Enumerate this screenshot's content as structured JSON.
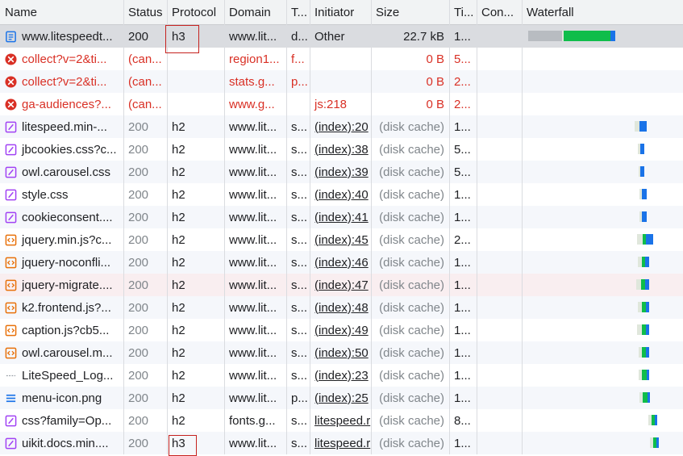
{
  "headers": {
    "name": "Name",
    "status": "Status",
    "protocol": "Protocol",
    "domain": "Domain",
    "type": "T...",
    "initiator": "Initiator",
    "size": "Size",
    "time": "Ti...",
    "connection": "Con...",
    "waterfall": "Waterfall"
  },
  "colors": {
    "error": "#d93025",
    "green": "#0fbd4a",
    "blue": "#1a73e8",
    "highlight": "#c5221f"
  },
  "rows": [
    {
      "icon": "document-icon",
      "name": "www.litespeedt...",
      "status": "200",
      "protocol": "h3",
      "domain": "www.lit...",
      "type": "d...",
      "initiator": "Other",
      "size": "22.7 kB",
      "time": "1...",
      "error": false,
      "link": false,
      "muted": false
    },
    {
      "icon": "error-icon",
      "name": "collect?v=2&ti...",
      "status": "(can...",
      "protocol": "",
      "domain": "region1...",
      "type": "f...",
      "initiator": "",
      "size": "0 B",
      "time": "5...",
      "error": true,
      "link": false,
      "muted": false
    },
    {
      "icon": "error-icon",
      "name": "collect?v=2&ti...",
      "status": "(can...",
      "protocol": "",
      "domain": "stats.g...",
      "type": "p...",
      "initiator": "",
      "size": "0 B",
      "time": "2...",
      "error": true,
      "link": false,
      "muted": false
    },
    {
      "icon": "error-icon",
      "name": "ga-audiences?...",
      "status": "(can...",
      "protocol": "",
      "domain": "www.g...",
      "type": "",
      "initiator": "js:218",
      "size": "0 B",
      "time": "2...",
      "error": true,
      "link": false,
      "muted": false
    },
    {
      "icon": "stylesheet-icon",
      "name": "litespeed.min-...",
      "status": "200",
      "protocol": "h2",
      "domain": "www.lit...",
      "type": "s...",
      "initiator": "(index):20",
      "size": "(disk cache)",
      "time": "1...",
      "error": false,
      "link": true,
      "muted": true
    },
    {
      "icon": "stylesheet-icon",
      "name": "jbcookies.css?c...",
      "status": "200",
      "protocol": "h2",
      "domain": "www.lit...",
      "type": "s...",
      "initiator": "(index):38",
      "size": "(disk cache)",
      "time": "5...",
      "error": false,
      "link": true,
      "muted": true
    },
    {
      "icon": "stylesheet-icon",
      "name": "owl.carousel.css",
      "status": "200",
      "protocol": "h2",
      "domain": "www.lit...",
      "type": "s...",
      "initiator": "(index):39",
      "size": "(disk cache)",
      "time": "5...",
      "error": false,
      "link": true,
      "muted": true
    },
    {
      "icon": "stylesheet-icon",
      "name": "style.css",
      "status": "200",
      "protocol": "h2",
      "domain": "www.lit...",
      "type": "s...",
      "initiator": "(index):40",
      "size": "(disk cache)",
      "time": "1...",
      "error": false,
      "link": true,
      "muted": true
    },
    {
      "icon": "stylesheet-icon",
      "name": "cookieconsent....",
      "status": "200",
      "protocol": "h2",
      "domain": "www.lit...",
      "type": "s...",
      "initiator": "(index):41",
      "size": "(disk cache)",
      "time": "1...",
      "error": false,
      "link": true,
      "muted": true
    },
    {
      "icon": "script-icon",
      "name": "jquery.min.js?c...",
      "status": "200",
      "protocol": "h2",
      "domain": "www.lit...",
      "type": "s...",
      "initiator": "(index):45",
      "size": "(disk cache)",
      "time": "2...",
      "error": false,
      "link": true,
      "muted": true
    },
    {
      "icon": "script-icon",
      "name": "jquery-noconfli...",
      "status": "200",
      "protocol": "h2",
      "domain": "www.lit...",
      "type": "s...",
      "initiator": "(index):46",
      "size": "(disk cache)",
      "time": "1...",
      "error": false,
      "link": true,
      "muted": true
    },
    {
      "icon": "script-icon",
      "name": "jquery-migrate....",
      "status": "200",
      "protocol": "h2",
      "domain": "www.lit...",
      "type": "s...",
      "initiator": "(index):47",
      "size": "(disk cache)",
      "time": "1...",
      "error": false,
      "link": true,
      "muted": true
    },
    {
      "icon": "script-icon",
      "name": "k2.frontend.js?...",
      "status": "200",
      "protocol": "h2",
      "domain": "www.lit...",
      "type": "s...",
      "initiator": "(index):48",
      "size": "(disk cache)",
      "time": "1...",
      "error": false,
      "link": true,
      "muted": true
    },
    {
      "icon": "script-icon",
      "name": "caption.js?cb5...",
      "status": "200",
      "protocol": "h2",
      "domain": "www.lit...",
      "type": "s...",
      "initiator": "(index):49",
      "size": "(disk cache)",
      "time": "1...",
      "error": false,
      "link": true,
      "muted": true
    },
    {
      "icon": "script-icon",
      "name": "owl.carousel.m...",
      "status": "200",
      "protocol": "h2",
      "domain": "www.lit...",
      "type": "s...",
      "initiator": "(index):50",
      "size": "(disk cache)",
      "time": "1...",
      "error": false,
      "link": true,
      "muted": true
    },
    {
      "icon": "image-icon",
      "name": "LiteSpeed_Log...",
      "status": "200",
      "protocol": "h2",
      "domain": "www.lit...",
      "type": "s...",
      "initiator": "(index):23",
      "size": "(disk cache)",
      "time": "1...",
      "error": false,
      "link": true,
      "muted": true
    },
    {
      "icon": "image-lines-icon",
      "name": "menu-icon.png",
      "status": "200",
      "protocol": "h2",
      "domain": "www.lit...",
      "type": "p...",
      "initiator": "(index):25",
      "size": "(disk cache)",
      "time": "1...",
      "error": false,
      "link": true,
      "muted": true
    },
    {
      "icon": "stylesheet-icon",
      "name": "css?family=Op...",
      "status": "200",
      "protocol": "h2",
      "domain": "fonts.g...",
      "type": "s...",
      "initiator": "litespeed.r",
      "size": "(disk cache)",
      "time": "8...",
      "error": false,
      "link": true,
      "muted": true
    },
    {
      "icon": "stylesheet-icon",
      "name": "uikit.docs.min....",
      "status": "200",
      "protocol": "h3",
      "domain": "www.lit...",
      "type": "s...",
      "initiator": "litespeed.r",
      "size": "(disk cache)",
      "time": "1...",
      "error": false,
      "link": true,
      "muted": true
    }
  ]
}
